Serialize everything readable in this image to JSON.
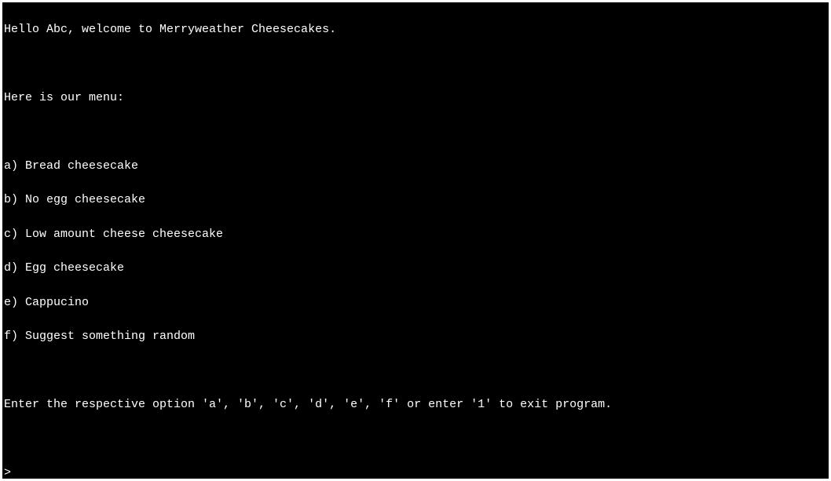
{
  "terminal": {
    "greeting": "Hello Abc, welcome to Merryweather Cheesecakes.",
    "menu_header": "Here is our menu:",
    "menu_items": {
      "a": "a) Bread cheesecake",
      "b": "b) No egg cheesecake",
      "c": "c) Low amount cheese cheesecake",
      "d": "d) Egg cheesecake",
      "e": "e) Cappucino",
      "f": "f) Suggest something random"
    },
    "prompt_instruction": "Enter the respective option 'a', 'b', 'c', 'd', 'e', 'f' or enter '1' to exit program.",
    "prompt_symbol": ">"
  }
}
